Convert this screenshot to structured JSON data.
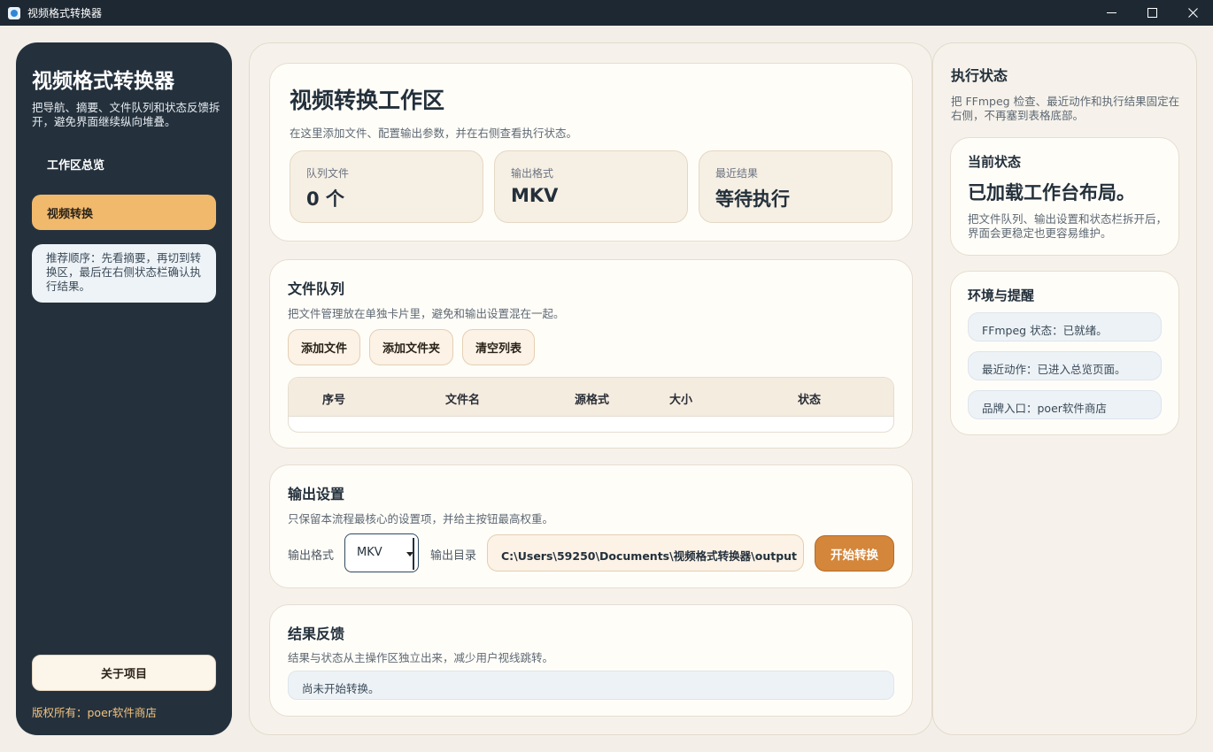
{
  "window": {
    "title": "视频格式转换器"
  },
  "sidebar": {
    "title": "视频格式转换器",
    "description": "把导航、摘要、文件队列和状态反馈拆开，避免界面继续纵向堆叠。",
    "nav": [
      {
        "label": "工作区总览",
        "active": false
      },
      {
        "label": "视频转换",
        "active": true
      }
    ],
    "tip": "推荐顺序：先看摘要，再切到转换区，最后在右侧状态栏确认执行结果。",
    "about_label": "关于项目",
    "copyright": "版权所有：poer软件商店"
  },
  "workspace": {
    "title": "视频转换工作区",
    "subtitle": "在这里添加文件、配置输出参数，并在右侧查看执行状态。",
    "stats": [
      {
        "label": "队列文件",
        "value": "0 个"
      },
      {
        "label": "输出格式",
        "value": "MKV"
      },
      {
        "label": "最近结果",
        "value": "等待执行"
      }
    ]
  },
  "queue": {
    "title": "文件队列",
    "subtitle": "把文件管理放在单独卡片里，避免和输出设置混在一起。",
    "buttons": {
      "add_file": "添加文件",
      "add_folder": "添加文件夹",
      "clear": "清空列表"
    },
    "columns": [
      "序号",
      "文件名",
      "源格式",
      "大小",
      "状态"
    ],
    "rows": []
  },
  "output": {
    "title": "输出设置",
    "subtitle": "只保留本流程最核心的设置项，并给主按钮最高权重。",
    "format_label": "输出格式",
    "format_value": "MKV",
    "dir_label": "输出目录",
    "dir_value": "C:\\Users\\59250\\Documents\\视频格式转换器\\output",
    "start_label": "开始转换"
  },
  "result": {
    "title": "结果反馈",
    "subtitle": "结果与状态从主操作区独立出来，减少用户视线跳转。",
    "message": "尚未开始转换。"
  },
  "status_panel": {
    "title": "执行状态",
    "description": "把 FFmpeg 检查、最近动作和执行结果固定在右侧，不再塞到表格底部。",
    "current": {
      "title": "当前状态",
      "value": "已加载工作台布局。",
      "description": "把文件队列、输出设置和状态栏拆开后，界面会更稳定也更容易维护。"
    },
    "env": {
      "title": "环境与提醒",
      "items": [
        "FFmpeg 状态：已就绪。",
        "最近动作：已进入总览页面。",
        "品牌入口：poer软件商店"
      ]
    }
  },
  "colors": {
    "sidebar_bg": "#24313d",
    "accent": "#f1b96c",
    "primary_button": "#d4863a",
    "titlebar_bg": "#1e2833"
  },
  "icons": [
    "app-icon",
    "minimize-icon",
    "maximize-icon",
    "close-icon",
    "chevron-down-icon"
  ]
}
